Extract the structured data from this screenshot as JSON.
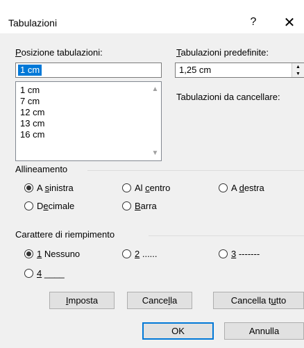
{
  "window": {
    "title": "Tabulazioni",
    "help_glyph": "?",
    "close_glyph": "✕"
  },
  "tab_positions": {
    "label_underlined": "P",
    "label_rest": "osizione tabulazioni:",
    "value": "1 cm",
    "list": [
      "1 cm",
      "7 cm",
      "12 cm",
      "13 cm",
      "16 cm"
    ]
  },
  "default_tabs": {
    "label_underlined": "T",
    "label_rest": "abulazioni predefinite:",
    "value": "1,25 cm"
  },
  "to_clear": {
    "label": "Tabulazioni da cancellare:"
  },
  "alignment": {
    "group_label": "Allineamento",
    "options": [
      {
        "pre": "A ",
        "u": "s",
        "post": "inistra",
        "selected": true
      },
      {
        "pre": "Al ",
        "u": "c",
        "post": "entro",
        "selected": false
      },
      {
        "pre": "A ",
        "u": "d",
        "post": "estra",
        "selected": false
      },
      {
        "pre": "D",
        "u": "e",
        "post": "cimale",
        "selected": false
      },
      {
        "pre": "",
        "u": "B",
        "post": "arra",
        "selected": false
      }
    ]
  },
  "leader": {
    "group_label": "Carattere di riempimento",
    "options": [
      {
        "pre": "",
        "u": "1",
        "post": " Nessuno",
        "selected": true
      },
      {
        "pre": "",
        "u": "2",
        "post": " ......",
        "selected": false
      },
      {
        "pre": "",
        "u": "3",
        "post": " -------",
        "selected": false
      },
      {
        "pre": "",
        "u": "4",
        "post": " ____",
        "selected": false
      }
    ]
  },
  "buttons": {
    "set": {
      "pre": "",
      "u": "I",
      "post": "mposta"
    },
    "clear": {
      "pre": "Cance",
      "u": "l",
      "post": "la"
    },
    "clear_all": {
      "pre": "Cancella t",
      "u": "u",
      "post": "tto"
    },
    "ok": "OK",
    "cancel": "Annulla"
  }
}
